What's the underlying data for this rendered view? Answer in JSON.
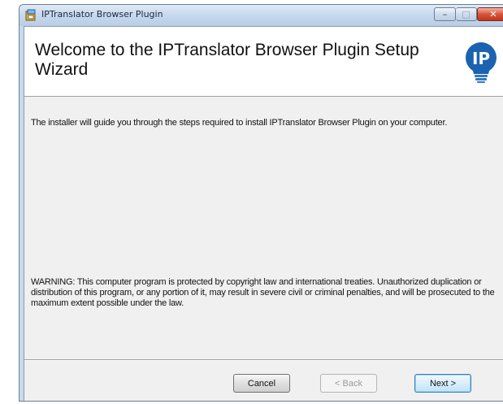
{
  "window": {
    "title": "IPTranslator Browser Plugin",
    "caption_buttons": {
      "minimize": "–",
      "maximize": "□",
      "close": "✕"
    }
  },
  "banner": {
    "heading": "Welcome to the IPTranslator Browser Plugin Setup Wizard",
    "logo_text": "IP"
  },
  "content": {
    "intro": "The installer will guide you through the steps required to install IPTranslator Browser Plugin on your computer.",
    "warning": "WARNING: This computer program is protected by copyright law and international treaties. Unauthorized duplication or distribution of this program, or any portion of it, may result in severe civil or criminal penalties, and will be prosecuted to the maximum extent possible under the law."
  },
  "buttons": {
    "cancel": "Cancel",
    "back": "< Back",
    "next": "Next >"
  },
  "colors": {
    "titlebar": "#c6d8ee",
    "dialog_bg": "#f0f0f0",
    "logo_blue": "#1b63b0",
    "close_red": "#d7543c"
  }
}
